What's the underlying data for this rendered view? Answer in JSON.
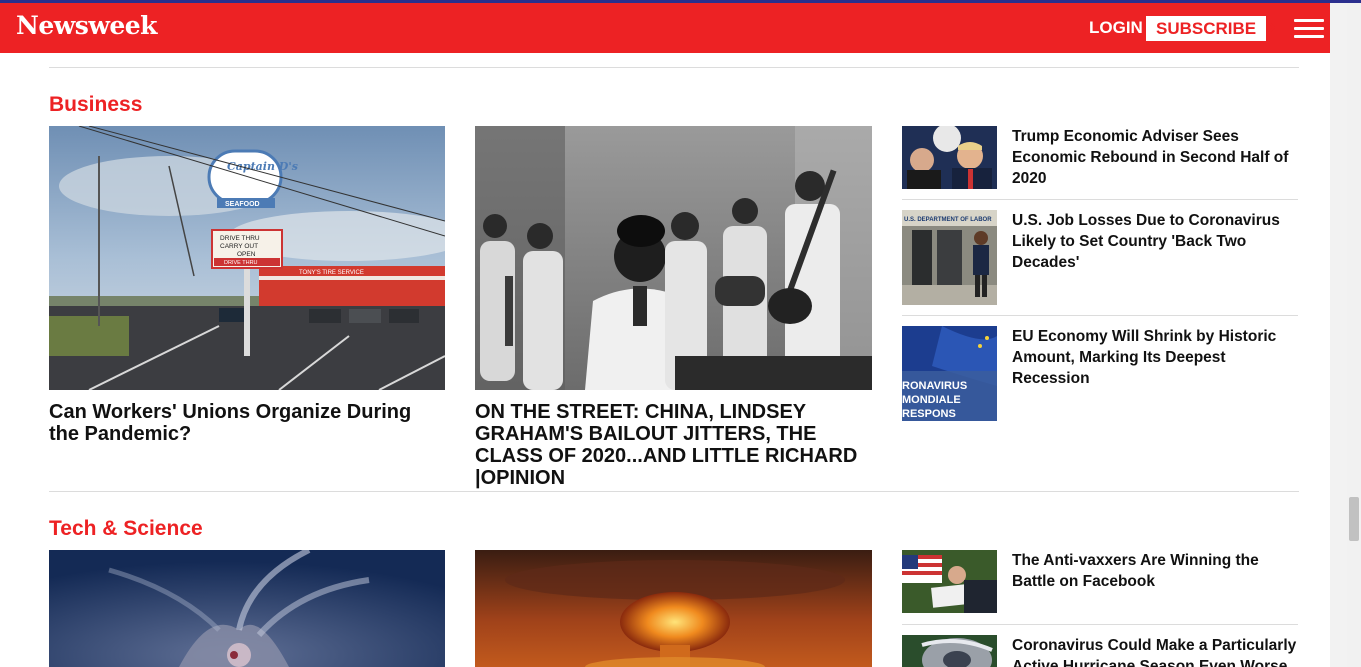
{
  "header": {
    "logo": "Newsweek",
    "login_label": "LOGIN",
    "subscribe_label": "SUBSCRIBE",
    "brand_color": "#ed2224",
    "icons": {
      "subscribe_arrow": "chevron-right-icon",
      "menu": "hamburger-menu-icon"
    }
  },
  "sections": [
    {
      "title": "Business",
      "featured": [
        {
          "headline": "Can Workers' Unions Organize During the Pandemic?"
        },
        {
          "headline": "ON THE STREET: CHINA, LINDSEY GRAHAM'S BAILOUT JITTERS, THE CLASS OF 2020...AND LITTLE RICHARD |OPINION"
        }
      ],
      "side": [
        {
          "headline": "Trump Economic Adviser Sees Economic Rebound in Second Half of 2020"
        },
        {
          "headline": "U.S. Job Losses Due to Coronavirus Likely to Set Country 'Back Two Decades'"
        },
        {
          "headline": "EU Economy Will Shrink by Historic Amount, Marking Its Deepest Recession"
        }
      ],
      "image_text": {
        "sign_brand": "Captain D's",
        "sign_seafood": "SEAFOOD",
        "sign_line1": "DRIVE THRU",
        "sign_line2": "CARRY   OUT",
        "sign_line3": "OPEN",
        "sign_line4": "DRIVE THRU",
        "store_sign": "TONY'S TIRE SERVICE",
        "dept_label": "U.S. DEPARTMENT OF LABOR",
        "eu_text_1": "RONAVIRUS",
        "eu_text_2": "MONDIALE",
        "eu_text_3": "RESPONS"
      }
    },
    {
      "title": "Tech & Science",
      "side": [
        {
          "headline": "The Anti-vaxxers Are Winning the Battle on Facebook"
        },
        {
          "headline": "Coronavirus Could Make a Particularly Active Hurricane Season Even Worse"
        }
      ]
    }
  ]
}
